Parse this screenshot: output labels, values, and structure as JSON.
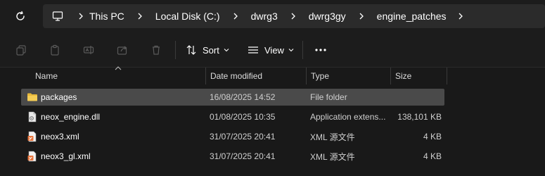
{
  "breadcrumb": {
    "items": [
      "This PC",
      "Local Disk (C:)",
      "dwrg3",
      "dwrg3gy",
      "engine_patches"
    ]
  },
  "toolbar": {
    "sort_label": "Sort",
    "view_label": "View"
  },
  "columns": {
    "name": "Name",
    "date_modified": "Date modified",
    "type": "Type",
    "size": "Size"
  },
  "files": [
    {
      "name": "packages",
      "date": "16/08/2025 14:52",
      "type": "File folder",
      "size": "",
      "icon": "folder-icon",
      "selected": true
    },
    {
      "name": "neox_engine.dll",
      "date": "01/08/2025 10:35",
      "type": "Application extens...",
      "size": "138,101 KB",
      "icon": "dll-file-icon",
      "selected": false
    },
    {
      "name": "neox3.xml",
      "date": "31/07/2025 20:41",
      "type": "XML 源文件",
      "size": "4 KB",
      "icon": "xml-file-icon",
      "selected": false
    },
    {
      "name": "neox3_gl.xml",
      "date": "31/07/2025 20:41",
      "type": "XML 源文件",
      "size": "4 KB",
      "icon": "xml-file-icon",
      "selected": false
    }
  ],
  "colors": {
    "background": "#191919",
    "selected_row": "#4a4a4a",
    "folder": "#f0c040",
    "xml_accent": "#e8743b"
  }
}
